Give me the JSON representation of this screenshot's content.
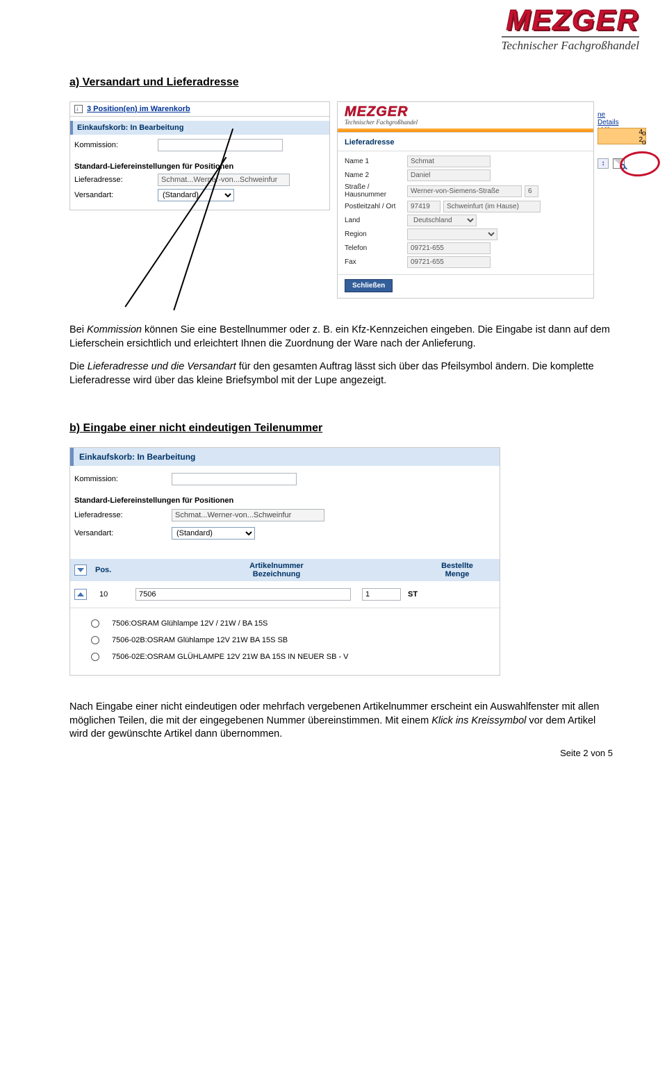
{
  "logo": {
    "brand": "MEZGER",
    "tagline": "Technischer Fachgroßhandel"
  },
  "section_a_head": "a) Versandart und Lieferadresse",
  "section_b_head": "b) Eingabe einer nicht eindeutigen Teilenummer",
  "para_a1_prefix": "Bei ",
  "para_a1_kommission": "Kommission",
  "para_a1_mid": " können Sie eine Bestellnummer oder z. B. ein Kfz-Kennzeichen eingeben. Die Eingabe ist dann auf dem Lieferschein ersichtlich und erleichtert Ihnen die Zuordnung der Ware nach der Anlieferung.",
  "para_a2_prefix": "Die ",
  "para_a2_italic": "Lieferadresse und die Versandart",
  "para_a2_rest": " für den gesamten Auftrag lässt sich über das Pfeilsymbol ändern. Die komplette Lieferadresse wird über das kleine Briefsymbol mit der Lupe angezeigt.",
  "para_b_prefix": "Nach Eingabe einer nicht eindeutigen oder mehrfach vergebenen Artikelnummer erscheint ein Auswahlfenster mit allen möglichen Teilen, die mit der eingegebenen Nummer übereinstimmen. Mit einem ",
  "para_b_italic": "Klick ins Kreissymbol",
  "para_b_rest": " vor dem Artikel wird der gewünschte Artikel dann übernommen.",
  "footer": "Seite 2 von 5",
  "shop": {
    "cart_link": "3 Position(en) im Warenkorb",
    "bluebar": "Einkaufskorb: In Bearbeitung",
    "kommission_lbl": "Kommission:",
    "delivery_sub": "Standard-Liefereinstellungen für Positionen",
    "lieferadresse_lbl": "Lieferadresse:",
    "lieferadresse_val": "Schmat...Werner-von...Schweinfur",
    "versandart_lbl": "Versandart:",
    "versandart_val": "(Standard)"
  },
  "right_link1": "ne Details",
  "right_link2": "Hil",
  "orange_r1": "4",
  "orange_r2": "2",
  "side_char": "o",
  "popup": {
    "title": "Lieferadresse",
    "name1_lbl": "Name 1",
    "name1_val": "Schmat",
    "name2_lbl": "Name 2",
    "name2_val": "Daniel",
    "strasse_lbl": "Straße / Hausnummer",
    "strasse_val": "Werner-von-Siemens-Straße",
    "hausnr_val": "6",
    "plz_lbl": "Postleitzahl / Ort",
    "plz_val": "97419",
    "ort_val": "Schweinfurt (im Hause)",
    "land_lbl": "Land",
    "land_val": "Deutschland",
    "region_lbl": "Region",
    "region_val": "",
    "tel_lbl": "Telefon",
    "tel_val": "09721-655",
    "fax_lbl": "Fax",
    "fax_val": "09721-655",
    "close": "Schließen"
  },
  "fig2": {
    "bluebar": "Einkaufskorb: In Bearbeitung",
    "kommission_lbl": "Kommission:",
    "delivery_sub": "Standard-Liefereinstellungen für Positionen",
    "lieferadresse_lbl": "Lieferadresse:",
    "lieferadresse_val": "Schmat...Werner-von...Schweinfur",
    "versandart_lbl": "Versandart:",
    "versandart_val": "(Standard)",
    "col_pos": "Pos.",
    "col_art_l1": "Artikelnummer",
    "col_art_l2": "Bezeichnung",
    "col_qty_l1": "Bestellte",
    "col_qty_l2": "Menge",
    "pos_val": "10",
    "art_val": "7506",
    "qty_val": "1",
    "unit": "ST",
    "opt1": "7506:OSRAM Glühlampe 12V / 21W / BA 15S",
    "opt2": "7506-02B:OSRAM Glühlampe 12V 21W BA 15S SB",
    "opt3": "7506-02E:OSRAM GLÜHLAMPE 12V 21W BA 15S IN NEUER SB - V"
  }
}
